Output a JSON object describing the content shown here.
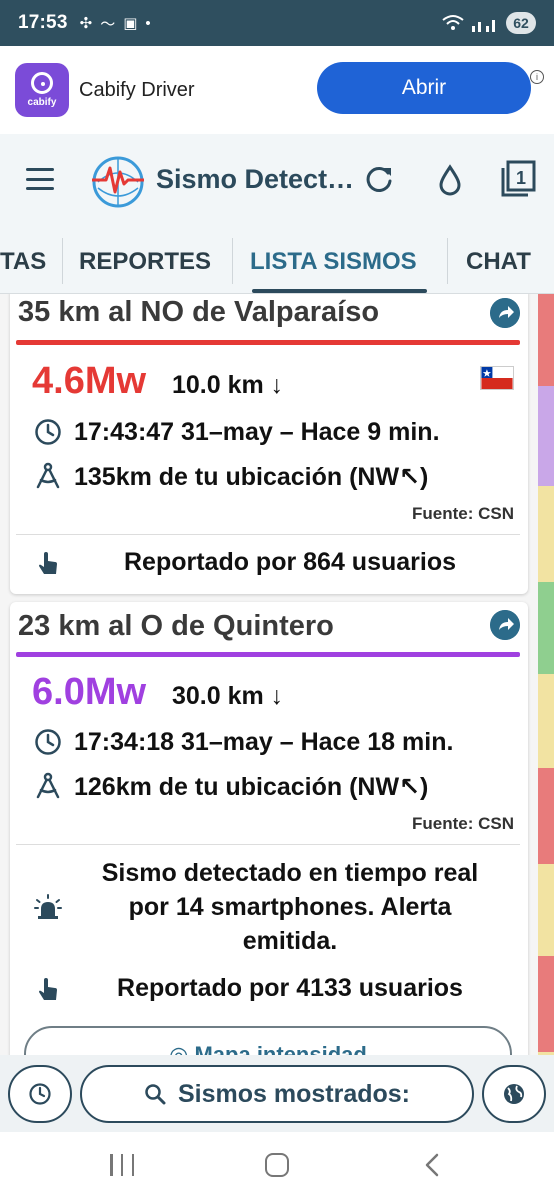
{
  "status_bar": {
    "time": "17:53",
    "battery": "62",
    "icons": [
      "link-icon",
      "heartbeat-icon",
      "tv-icon",
      "dot-icon",
      "wifi-icon",
      "signal-icon"
    ]
  },
  "ad": {
    "brand": "cabify",
    "title": "Cabify Driver",
    "button": "Abrir",
    "info": "i"
  },
  "app_bar": {
    "title": "Sismo Detect…",
    "count_badge": "1"
  },
  "tabs": [
    {
      "label": "TAS",
      "active": false
    },
    {
      "label": "REPORTES",
      "active": false
    },
    {
      "label": "LISTA SISMOS",
      "active": true
    },
    {
      "label": "CHAT",
      "active": false
    }
  ],
  "side_strip_colors": [
    "#e87b7b",
    "#c9a7e8",
    "#f2e3a2",
    "#8fcf8f",
    "#f2e3a2",
    "#e87b7b",
    "#f2e3a2",
    "#e87b7b",
    "#f2e3a2"
  ],
  "quakes": [
    {
      "title": "35 km al NO de Valparaíso",
      "color": "#e53935",
      "magnitude": "4.6Mw",
      "depth": "10.0 km ↓",
      "time": "17:43:47 31–may – Hace 9 min.",
      "distance": "135km de tu ubicación (NW↖)",
      "source": "Fuente: CSN",
      "report": "Reportado por 864 usuarios",
      "flag": "chile"
    },
    {
      "title": "23 km al O de Quintero",
      "color": "#a040e0",
      "magnitude": "6.0Mw",
      "depth": "30.0 km ↓",
      "time": "17:34:18 31–may – Hace 18 min.",
      "distance": "126km de tu ubicación (NW↖)",
      "source": "Fuente: CSN",
      "detection_lines": [
        "Sismo detectado en tiempo real",
        "por 14 smartphones. Alerta",
        "emitida."
      ],
      "report": "Reportado por 4133 usuarios",
      "map_button": "◎ Mapa intensidad"
    }
  ],
  "bottom_bar": {
    "search_label": "Sismos mostrados:"
  }
}
